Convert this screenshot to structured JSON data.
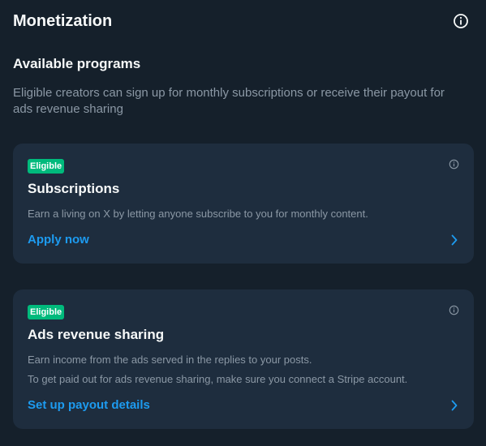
{
  "header": {
    "title": "Monetization",
    "info_icon": "info-circle-icon"
  },
  "section": {
    "title": "Available programs",
    "description": "Eligible creators can sign up for monthly subscriptions or receive their payout for ads revenue sharing"
  },
  "cards": [
    {
      "badge": "Eligible",
      "title": "Subscriptions",
      "descriptions": [
        "Earn a living on X by letting anyone subscribe to you for monthly content."
      ],
      "action_label": "Apply now",
      "info_icon": "info-circle-icon",
      "action_icon": "chevron-right-icon"
    },
    {
      "badge": "Eligible",
      "title": "Ads revenue sharing",
      "descriptions": [
        "Earn income from the ads served in the replies to your posts.",
        "To get paid out for ads revenue sharing, make sure you connect a Stripe account."
      ],
      "action_label": "Set up payout details",
      "info_icon": "info-circle-icon",
      "action_icon": "chevron-right-icon"
    }
  ],
  "colors": {
    "background": "#15202b",
    "card_background": "#1e2d3e",
    "badge": "#00ba7c",
    "link": "#1d9bf0",
    "primary_text": "#f7f9f9",
    "secondary_text": "#8b98a5"
  }
}
